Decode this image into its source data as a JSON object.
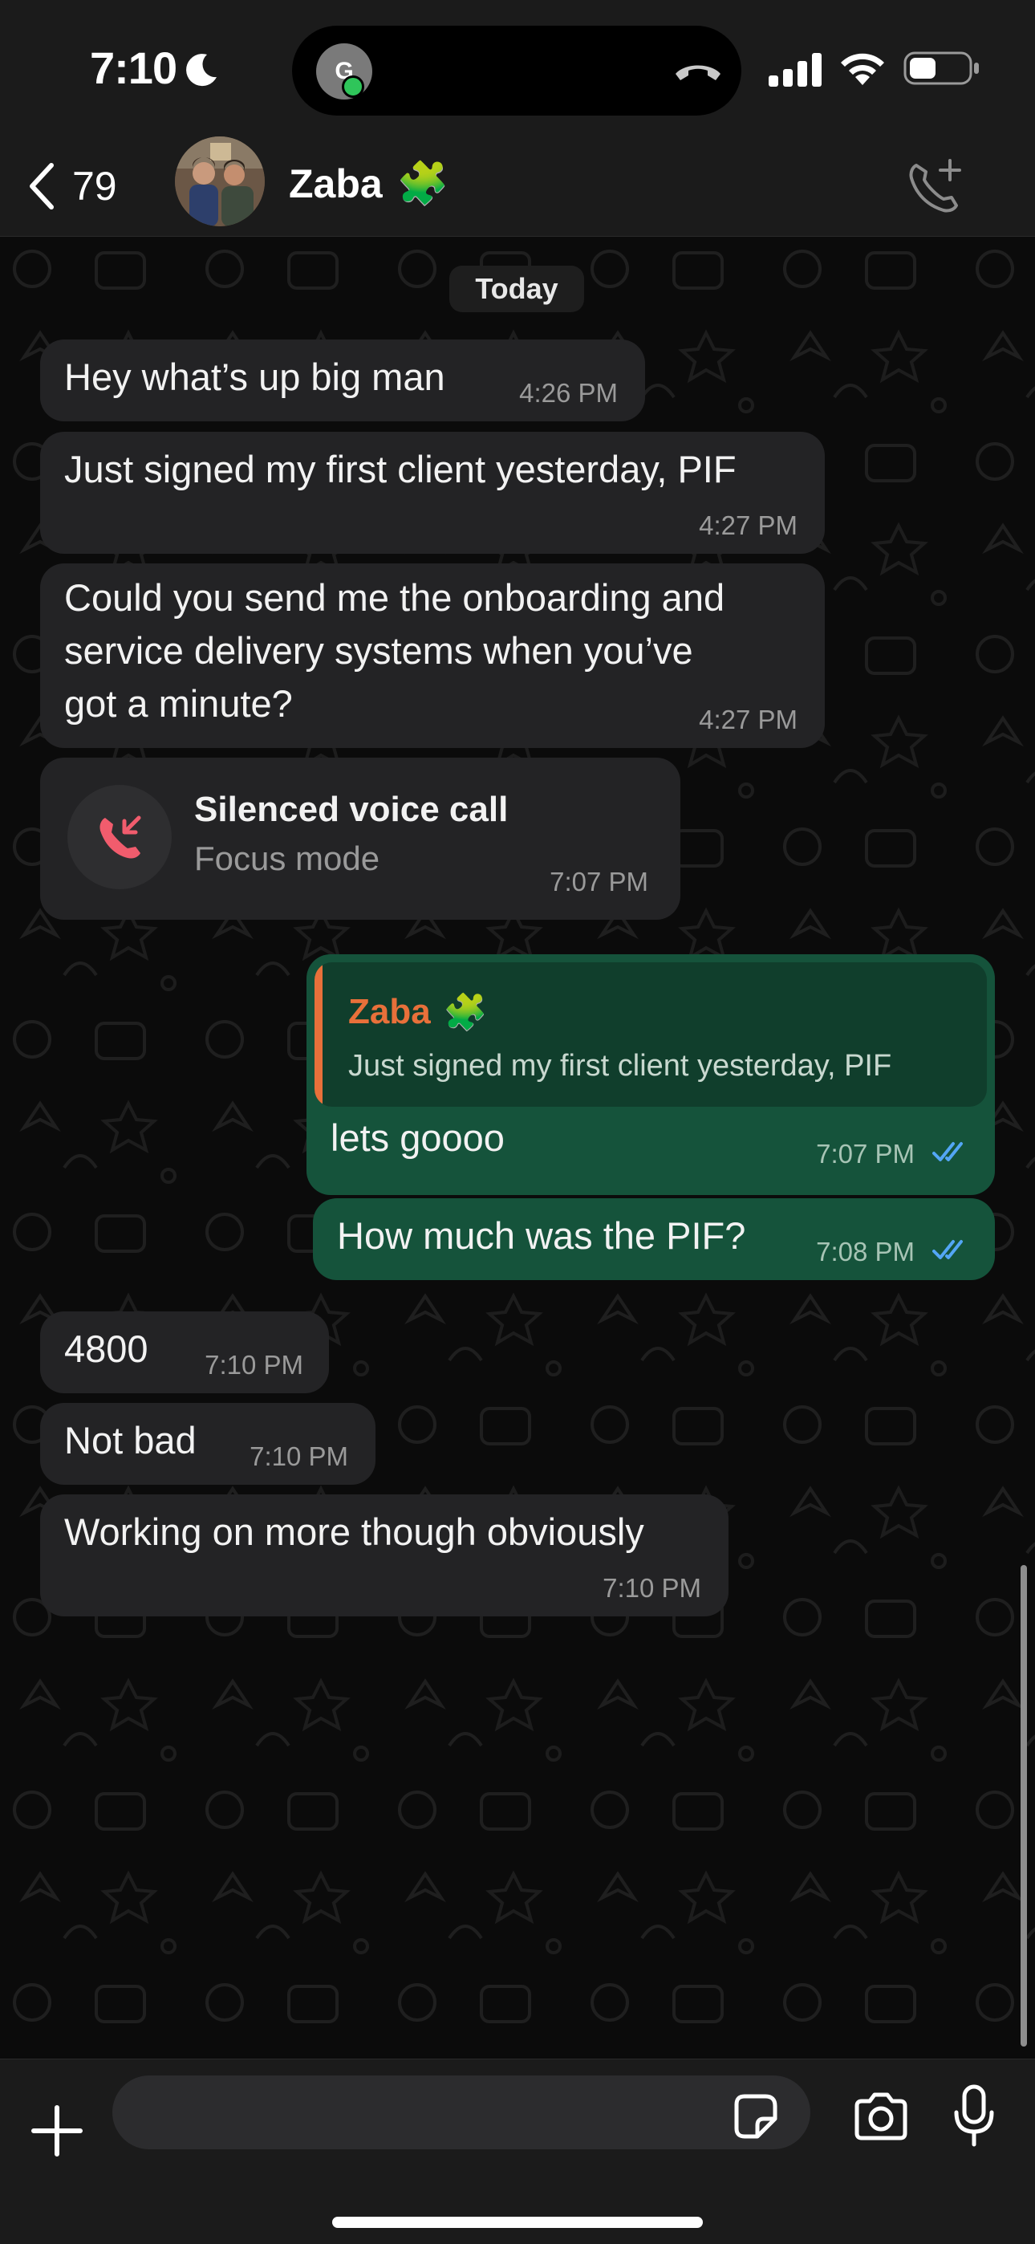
{
  "status_bar": {
    "time": "7:10",
    "island_avatar_initial": "G"
  },
  "header": {
    "back_count": "79",
    "contact_name": "Zaba",
    "contact_emoji": "🧩"
  },
  "chat": {
    "date_label": "Today",
    "messages": [
      {
        "direction": "in",
        "text": "Hey what’s up big man",
        "time": "4:26 PM"
      },
      {
        "direction": "in",
        "text": "Just signed my first client yesterday, PIF",
        "time": "4:27 PM"
      },
      {
        "direction": "in",
        "text": "Could you send me the onboarding and service delivery systems when you’ve got a minute?",
        "lines": [
          "Could you send me the onboarding and",
          "service delivery systems when you’ve",
          "got a minute?"
        ],
        "time": "4:27 PM"
      },
      {
        "direction": "in",
        "type": "call",
        "title": "Silenced voice call",
        "subtitle": "Focus mode",
        "time": "7:07 PM"
      },
      {
        "direction": "out",
        "reply_to": {
          "name": "Zaba",
          "emoji": "🧩",
          "text": "Just signed my first client yesterday, PIF"
        },
        "text": "lets goooo",
        "time": "7:07 PM",
        "status": "read"
      },
      {
        "direction": "out",
        "text": "How much was the PIF?",
        "time": "7:08 PM",
        "status": "read"
      },
      {
        "direction": "in",
        "text": "4800",
        "time": "7:10 PM"
      },
      {
        "direction": "in",
        "text": "Not bad",
        "time": "7:10 PM"
      },
      {
        "direction": "in",
        "text": "Working on more though obviously",
        "time": "7:10 PM"
      }
    ]
  },
  "input": {
    "placeholder": ""
  },
  "colors": {
    "outgoing_bubble": "#15533b",
    "incoming_bubble": "#232325",
    "reply_name": "#e8703a",
    "read_ticks": "#53a6f5",
    "missed_call": "#f15c6d"
  },
  "icons": [
    "moon-icon",
    "hangup-icon",
    "signal-icon",
    "wifi-icon",
    "battery-icon",
    "back-chevron-icon",
    "add-call-icon",
    "missed-call-icon",
    "plus-icon",
    "sticker-icon",
    "camera-icon",
    "mic-icon"
  ]
}
